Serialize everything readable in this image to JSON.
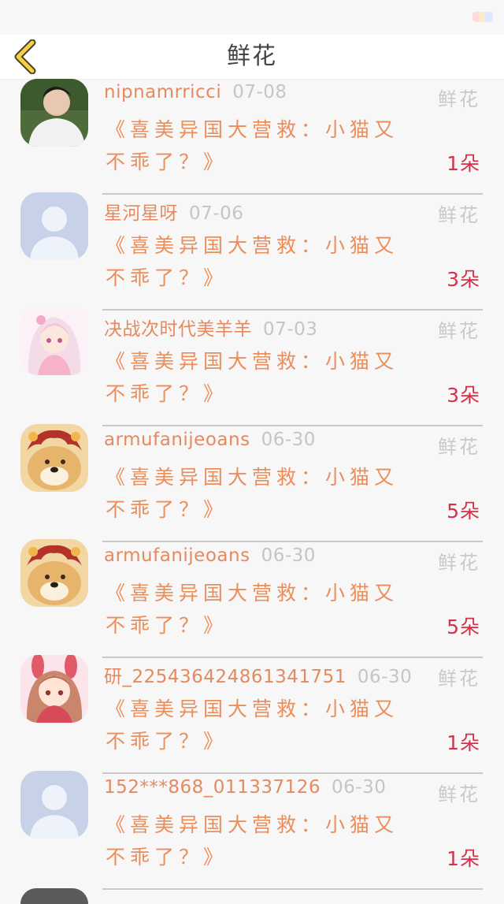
{
  "header": {
    "title": "鲜花",
    "back_icon": "back-chevron-icon"
  },
  "colors": {
    "username": "#e58a5f",
    "work_title": "#ea8e5c",
    "date": "#c5c5c5",
    "count": "#d4324a",
    "back_chevron": "#f2d14a"
  },
  "gifts": [
    {
      "user": "nipnamrricci",
      "date": "07-08",
      "type": "鲜花",
      "work_line1": "《喜美异国大营救：小猫又",
      "work_line2": "不乖了？》",
      "count": "1朵",
      "avatar": "photo-avatar"
    },
    {
      "user": "星河星呀",
      "date": "07-06",
      "type": "鲜花",
      "work_line1": "《喜美异国大营救：小猫又",
      "work_line2": "不乖了？》",
      "count": "3朵",
      "avatar": "default-avatar"
    },
    {
      "user": "决战次时代美羊羊",
      "date": "07-03",
      "type": "鲜花",
      "work_line1": "《喜美异国大营救：小猫又",
      "work_line2": "不乖了？》",
      "count": "3朵",
      "avatar": "anime-girl-avatar"
    },
    {
      "user": "armufanijeoans",
      "date": "06-30",
      "type": "鲜花",
      "work_line1": "《喜美异国大营救：小猫又",
      "work_line2": "不乖了？》",
      "count": "5朵",
      "avatar": "doge-avatar"
    },
    {
      "user": "armufanijeoans",
      "date": "06-30",
      "type": "鲜花",
      "work_line1": "《喜美异国大营救：小猫又",
      "work_line2": "不乖了？》",
      "count": "5朵",
      "avatar": "doge-avatar"
    },
    {
      "user": "研_2254364248613417​51",
      "date": "06-30",
      "type": "鲜花",
      "work_line1": "《喜美异国大营救：小猫又",
      "work_line2": "不乖了？》",
      "count": "1朵",
      "avatar": "anime-bunny-avatar"
    },
    {
      "user": "152***868_011337126",
      "date": "06-30",
      "type": "鲜花",
      "work_line1": "《喜美异国大营救：小猫又",
      "work_line2": "不乖了？》",
      "count": "1朵",
      "avatar": "default-avatar"
    }
  ]
}
